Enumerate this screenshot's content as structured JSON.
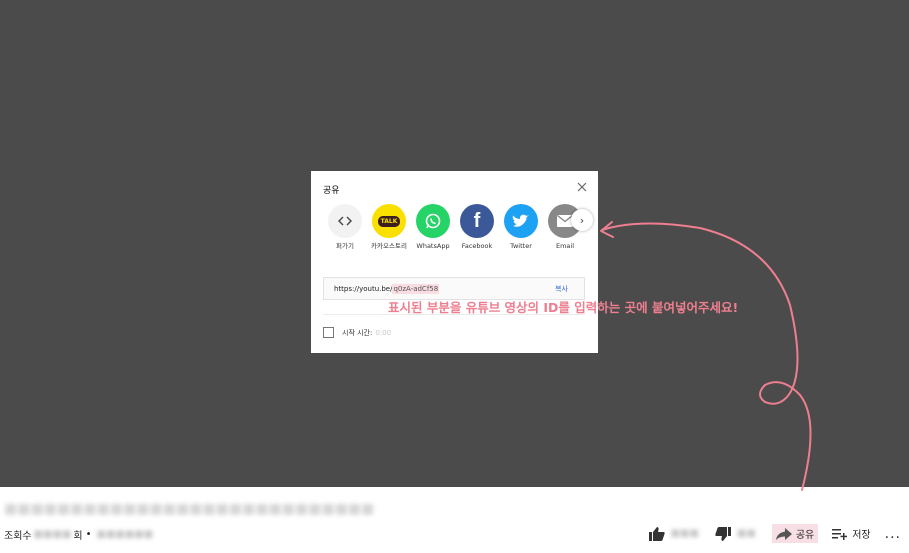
{
  "dialog": {
    "title": "공유",
    "share_targets": [
      {
        "label": "퍼가기",
        "icon": "embed-icon"
      },
      {
        "label": "카카오스토리",
        "icon": "kakaotalk-icon",
        "badge": "TALK"
      },
      {
        "label": "WhatsApp",
        "icon": "whatsapp-icon"
      },
      {
        "label": "Facebook",
        "icon": "facebook-icon"
      },
      {
        "label": "Twitter",
        "icon": "twitter-icon"
      },
      {
        "label": "Email",
        "icon": "email-icon"
      }
    ],
    "url_prefix": "https://youtu.be/",
    "url_id": "q0zA-adCf58",
    "copy_label": "복사",
    "start_label": "시작 시간",
    "start_time": "0:00"
  },
  "annotation": "표시된 부분을 유튜브 영상의 ID를 입력하는 곳에 붙여넣어주세요!",
  "video": {
    "views_label": "조회수",
    "views_unit": "회",
    "share_label": "공유",
    "save_label": "저장",
    "more_label": "..."
  },
  "colors": {
    "backdrop": "#4b4b4b",
    "annotation": "#ee7f90",
    "kakao": "#f9e000",
    "whatsapp": "#25d366",
    "facebook": "#3b5998",
    "twitter": "#1da1f2",
    "email": "#888888",
    "copy_link": "#3a6fd8"
  }
}
